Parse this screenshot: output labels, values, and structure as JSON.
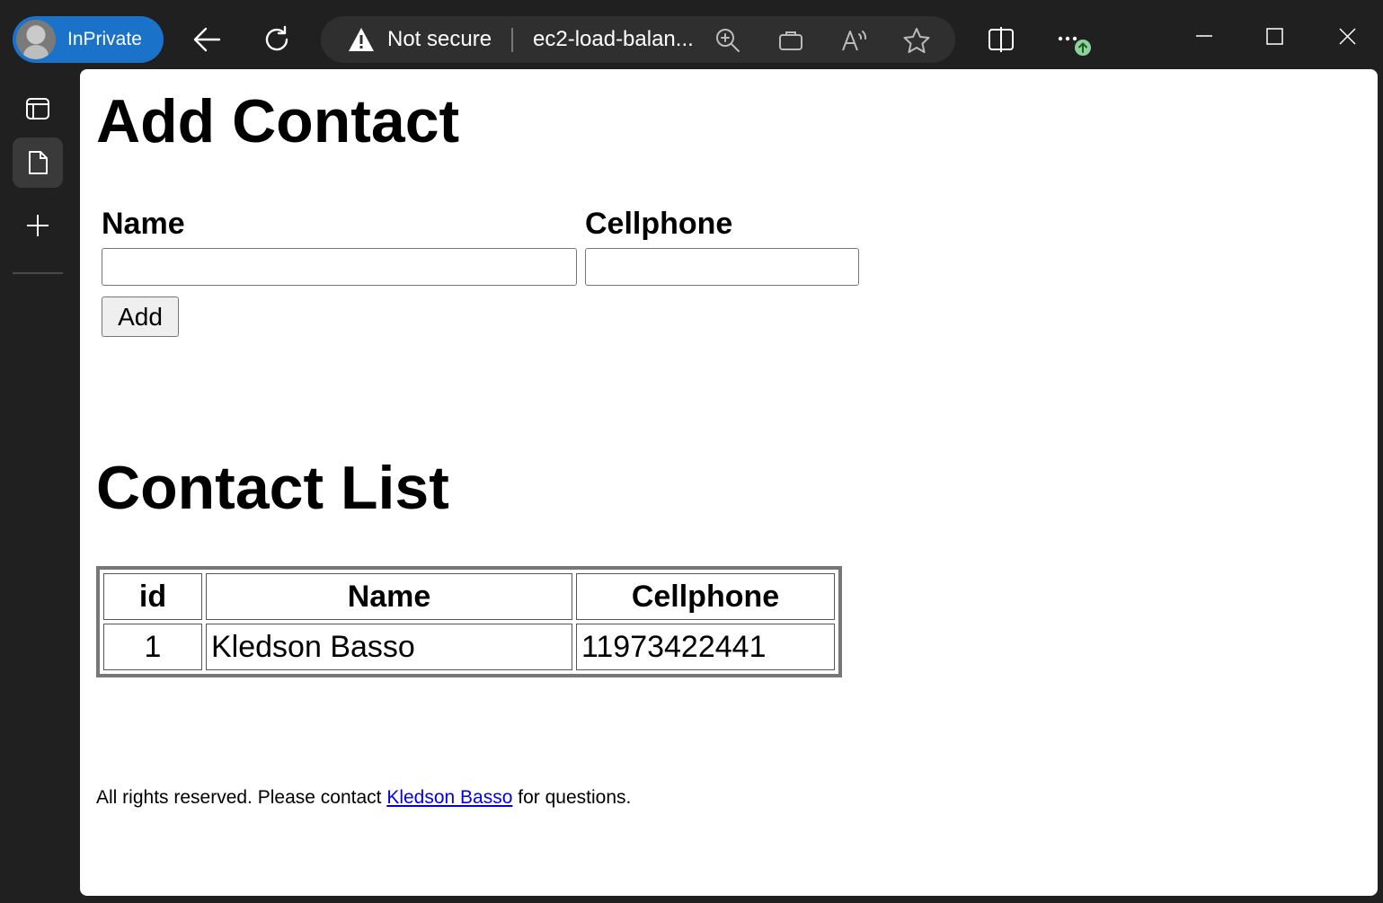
{
  "browser": {
    "profile_label": "InPrivate",
    "security_text": "Not secure",
    "url_text": "ec2-load-balan..."
  },
  "page": {
    "add_heading": "Add Contact",
    "form": {
      "name_label": "Name",
      "name_value": "",
      "cellphone_label": "Cellphone",
      "cellphone_value": "",
      "add_button": "Add"
    },
    "list_heading": "Contact List",
    "table": {
      "headers": [
        "id",
        "Name",
        "Cellphone"
      ],
      "rows": [
        [
          "1",
          "Kledson Basso",
          "11973422441"
        ]
      ]
    },
    "footer": {
      "text_before": "All rights reserved. Please contact ",
      "link_text": "Kledson Basso",
      "text_after": " for questions."
    }
  }
}
